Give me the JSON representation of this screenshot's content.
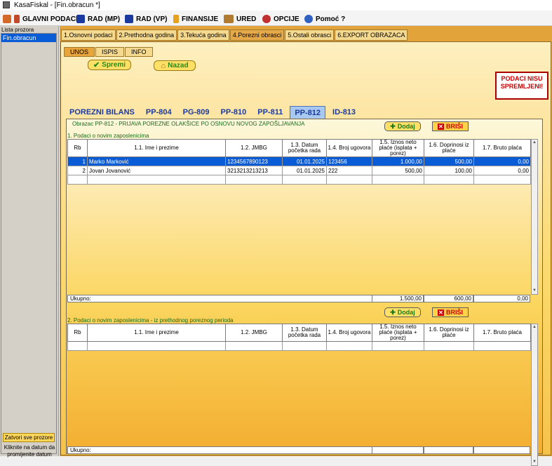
{
  "window": {
    "title": "KasaFiskal  - [Fin.obracun *]"
  },
  "menu": [
    {
      "label": "GLAVNI PODACI",
      "icon": "books-icon"
    },
    {
      "label": "RAD (MP)",
      "icon": "shield-icon"
    },
    {
      "label": "RAD (VP)",
      "icon": "shield-icon"
    },
    {
      "label": "FINANSIJE",
      "icon": "chart-icon"
    },
    {
      "label": "URED",
      "icon": "briefcase-icon"
    },
    {
      "label": "OPCIJE",
      "icon": "options-icon"
    },
    {
      "label": "Pomoć ?",
      "icon": "help-icon"
    }
  ],
  "sidebar": {
    "title": "Lista prozora",
    "items": [
      "Fin.obracun"
    ],
    "close_all": "Zatvori sve prozore",
    "hint": "Kliknite na datum da promijenite datum"
  },
  "tabs": [
    "1.Osnovni podaci",
    "2.Prethodna godina",
    "3.Tekuća godina",
    "4.Porezni obrasci",
    "5.Ostali obrasci",
    "6.EXPORT OBRAZACA"
  ],
  "subtabs": [
    "UNOS",
    "ISPIS",
    "INFO"
  ],
  "buttons": {
    "spremi": "Spremi",
    "nazad": "Nazad",
    "dodaj": "Dodaj",
    "brisi": "BRIŠI"
  },
  "warning": "PODACI NISU SPREMLJENI!",
  "form_tabs": [
    "POREZNI BILANS",
    "PP-804",
    "PG-809",
    "PP-810",
    "PP-811",
    "PP-812",
    "ID-813"
  ],
  "form_title": "Obrazac PP-812 - PRIJAVA POREZNE OLAKŠICE PO OSNOVU NOVOG ZAPOŠLJAVANJA",
  "section1": {
    "title": "1. Podaci o novim zaposlenicima",
    "headers": [
      "Rb",
      "1.1. Ime i prezime",
      "1.2. JMBG",
      "1.3. Datum početka rada",
      "1.4. Broj ugovora",
      "1.5. Iznos neto plaće (isplata + porez)",
      "1.6. Doprinosi iz plaće",
      "1.7. Bruto plaća"
    ],
    "rows": [
      [
        "1",
        "Marko Marković",
        "1234567890123",
        "01.01.2025",
        "123456",
        "1.000,00",
        "500,00",
        "0,00"
      ],
      [
        "2",
        "Jovan Jovanović",
        "3213213213213",
        "01.01.2025",
        "222",
        "500,00",
        "100,00",
        "0,00"
      ]
    ],
    "total_label": "Ukupno:",
    "totals": [
      "1.500,00",
      "600,00",
      "0,00"
    ]
  },
  "section2": {
    "title": "2. Podaci o novim zaposlenicima - iz prethodnog poreznog perioda",
    "headers": [
      "Rb",
      "1.1. Ime i prezime",
      "1.2. JMBG",
      "1.3. Datum početka rada",
      "1.4. Broj ugovora",
      "1.5. Iznos neto plaće (isplata + porez)",
      "1.6. Doprinosi iz plaće",
      "1.7. Bruto plaća"
    ],
    "total_label": "Ukupno:"
  }
}
